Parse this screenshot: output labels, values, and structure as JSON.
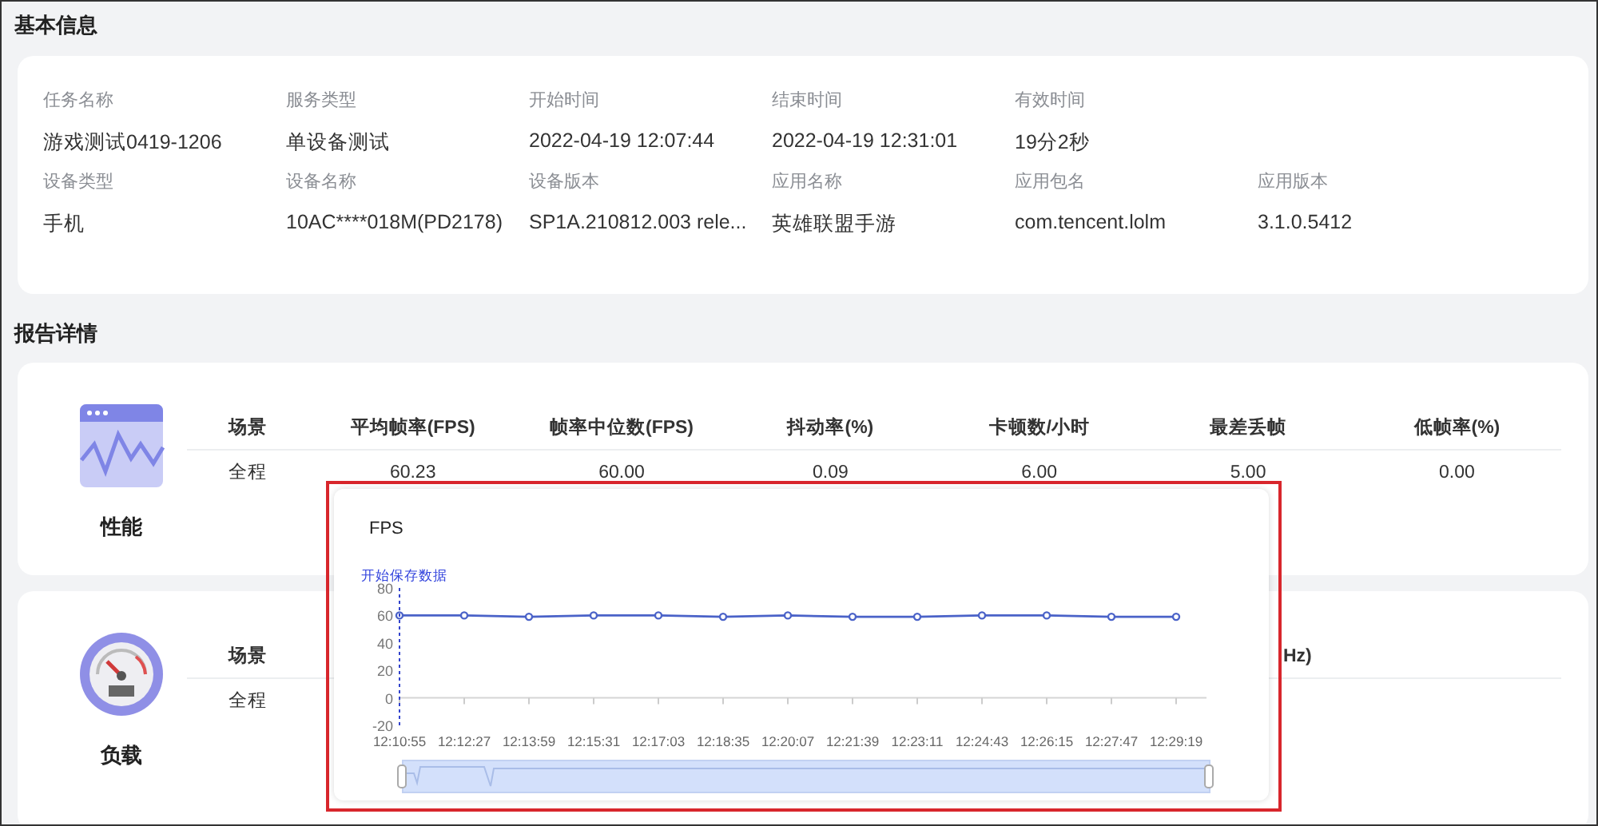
{
  "basic_info": {
    "title": "基本信息",
    "fields": [
      {
        "label": "任务名称",
        "value": "游戏测试0419-1206"
      },
      {
        "label": "服务类型",
        "value": "单设备测试"
      },
      {
        "label": "开始时间",
        "value": "2022-04-19 12:07:44"
      },
      {
        "label": "结束时间",
        "value": "2022-04-19 12:31:01"
      },
      {
        "label": "有效时间",
        "value": "19分2秒"
      },
      {
        "label": "设备类型",
        "value": "手机"
      },
      {
        "label": "设备名称",
        "value": "10AC****018M(PD2178)"
      },
      {
        "label": "设备版本",
        "value": "SP1A.210812.003 rele..."
      },
      {
        "label": "应用名称",
        "value": "英雄联盟手游"
      },
      {
        "label": "应用包名",
        "value": "com.tencent.lolm"
      },
      {
        "label": "应用版本",
        "value": "3.1.0.5412"
      }
    ]
  },
  "report": {
    "title": "报告详情",
    "cards": [
      {
        "kind": "performance",
        "label": "性能",
        "table": {
          "columns": [
            "场景",
            "平均帧率(FPS)",
            "帧率中位数(FPS)",
            "抖动率(%)",
            "卡顿数/小时",
            "最差丢帧",
            "低帧率(%)"
          ],
          "rows": [
            [
              "全程",
              "60.23",
              "60.00",
              "0.09",
              "6.00",
              "5.00",
              "0.00"
            ]
          ]
        }
      },
      {
        "kind": "load",
        "label": "负载",
        "table": {
          "columns": [
            "场景",
            "Hz)"
          ],
          "rows": [
            [
              "全程"
            ]
          ]
        }
      }
    ]
  },
  "popup": {
    "chart_data": {
      "type": "line",
      "title": "FPS",
      "categories": [
        "12:10:55",
        "12:12:27",
        "12:13:59",
        "12:15:31",
        "12:17:03",
        "12:18:35",
        "12:20:07",
        "12:21:39",
        "12:23:11",
        "12:24:43",
        "12:26:15",
        "12:27:47",
        "12:29:19"
      ],
      "series": [
        {
          "color": "#4a62c8",
          "marker": true,
          "values": [
            60,
            60,
            59,
            60,
            60,
            59,
            60,
            59,
            59,
            60,
            60,
            59,
            59
          ]
        }
      ],
      "ylim": [
        -20,
        80
      ],
      "yticks": [
        -20,
        0,
        20,
        40,
        60,
        80
      ],
      "annotations": [
        "开始保存数据"
      ]
    }
  }
}
